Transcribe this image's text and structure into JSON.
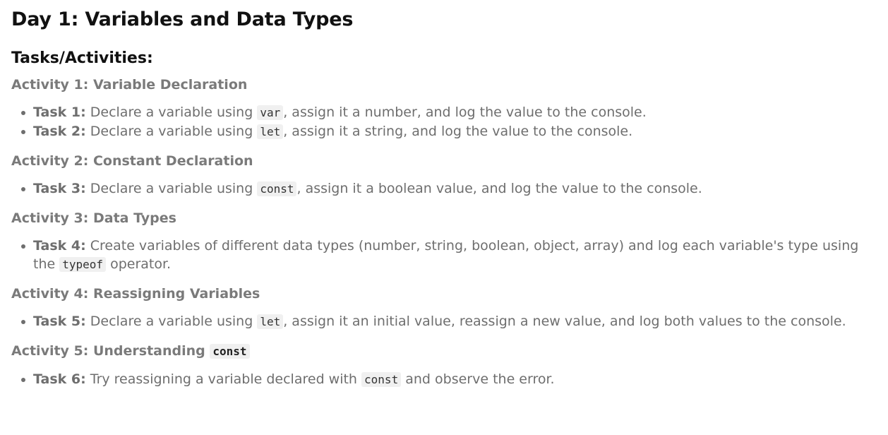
{
  "title": "Day 1: Variables and Data Types",
  "subtitle": "Tasks/Activities:",
  "activities": [
    {
      "heading": "Activity 1: Variable Declaration",
      "tasks": [
        {
          "label": "Task 1:",
          "before": " Declare a variable using ",
          "code": "var",
          "after": ", assign it a number, and log the value to the console."
        },
        {
          "label": "Task 2:",
          "before": " Declare a variable using ",
          "code": "let",
          "after": ", assign it a string, and log the value to the console."
        }
      ]
    },
    {
      "heading": "Activity 2: Constant Declaration",
      "tasks": [
        {
          "label": "Task 3:",
          "before": " Declare a variable using ",
          "code": "const",
          "after": ", assign it a boolean value, and log the value to the console."
        }
      ]
    },
    {
      "heading": "Activity 3: Data Types",
      "tasks": [
        {
          "label": "Task 4:",
          "before": " Create variables of different data types (number, string, boolean, object, array) and log each variable's type using the ",
          "code": "typeof",
          "after": " operator."
        }
      ]
    },
    {
      "heading": "Activity 4: Reassigning Variables",
      "tasks": [
        {
          "label": "Task 5:",
          "before": " Declare a variable using ",
          "code": "let",
          "after": ", assign it an initial value, reassign a new value, and log both values to the console."
        }
      ]
    },
    {
      "heading": "Activity 5: Understanding ",
      "heading_code": "const",
      "tasks": [
        {
          "label": "Task 6:",
          "before": " Try reassigning a variable declared with ",
          "code": "const",
          "after": " and observe the error."
        }
      ]
    }
  ]
}
